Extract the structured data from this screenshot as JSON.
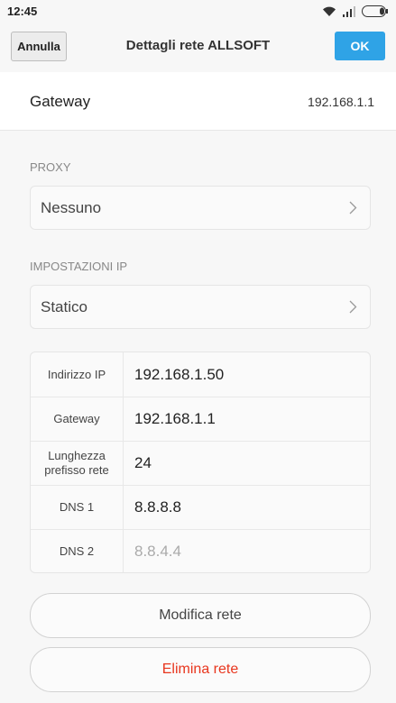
{
  "status_bar": {
    "time": "12:45"
  },
  "header": {
    "cancel_label": "Annulla",
    "title": "Dettagli rete ALLSOFT",
    "ok_label": "OK"
  },
  "gateway": {
    "label": "Gateway",
    "value": "192.168.1.1"
  },
  "proxy": {
    "section_label": "PROXY",
    "value": "Nessuno"
  },
  "ip_settings": {
    "section_label": "IMPOSTAZIONI IP",
    "value": "Statico"
  },
  "ip_fields": [
    {
      "label": "Indirizzo IP",
      "value": "192.168.1.50"
    },
    {
      "label": "Gateway",
      "value": "192.168.1.1"
    },
    {
      "label": "Lunghezza prefisso rete",
      "value": "24"
    },
    {
      "label": "DNS 1",
      "value": "8.8.8.8"
    },
    {
      "label": "DNS 2",
      "placeholder": "8.8.4.4"
    }
  ],
  "actions": {
    "modify_label": "Modifica rete",
    "delete_label": "Elimina rete"
  },
  "colors": {
    "accent": "#2fa3e6",
    "danger": "#e8361e"
  },
  "icons": [
    "wifi-icon",
    "signal-icon",
    "battery-icon",
    "chevron-right-icon"
  ]
}
